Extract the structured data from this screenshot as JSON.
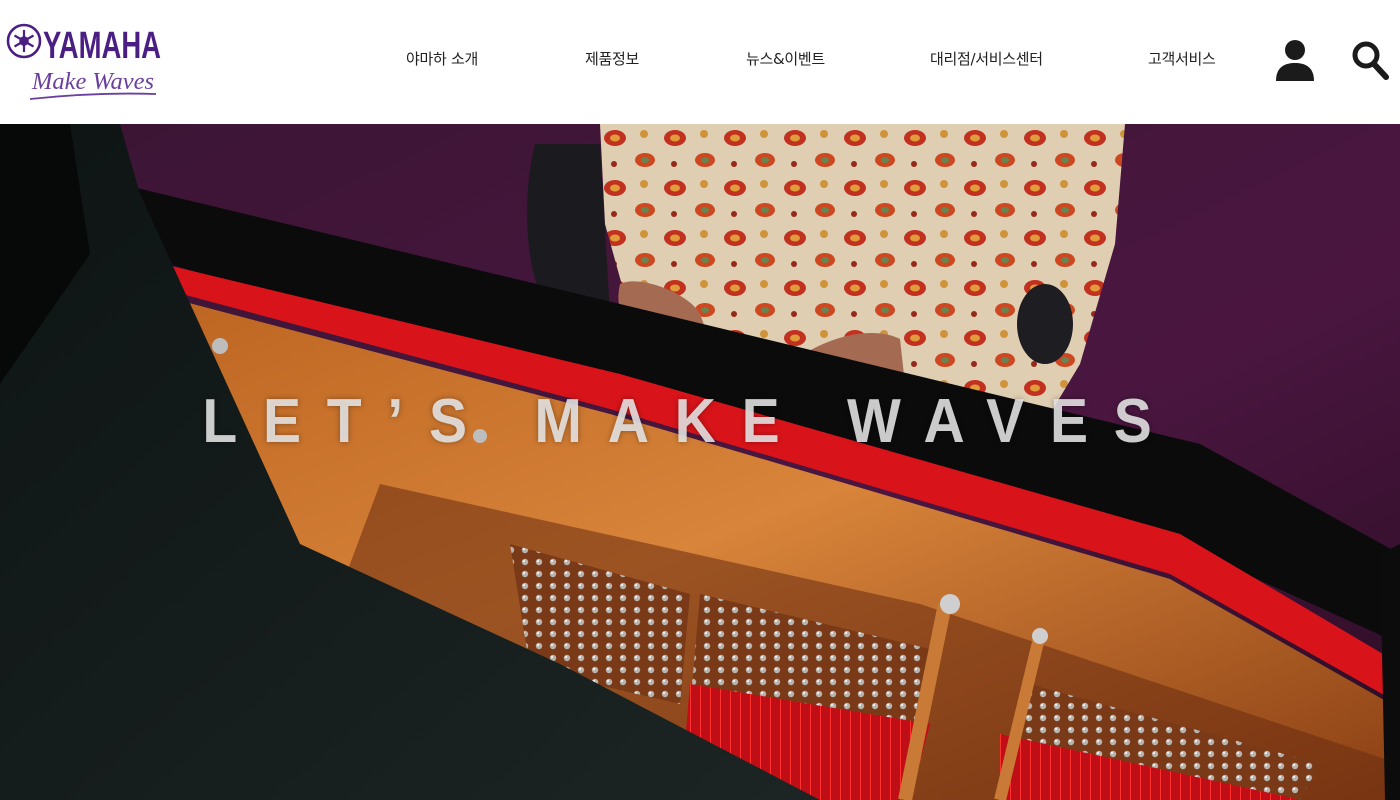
{
  "brand": {
    "name": "YAMAHA",
    "tagline": "Make Waves",
    "color": "#4b1e84"
  },
  "nav": {
    "items": [
      {
        "label": "야마하 소개"
      },
      {
        "label": "제품정보"
      },
      {
        "label": "뉴스&이벤트"
      },
      {
        "label": "대리점/서비스센터"
      },
      {
        "label": "고객서비스"
      }
    ],
    "icons": [
      "user-icon",
      "search-icon"
    ]
  },
  "hero": {
    "headline": "LET’S MAKE WAVES"
  },
  "colors": {
    "nav_text": "#222222",
    "hero_background": "#3a1030",
    "piano_red": "#d8141a",
    "piano_gold": "#c8702a"
  }
}
